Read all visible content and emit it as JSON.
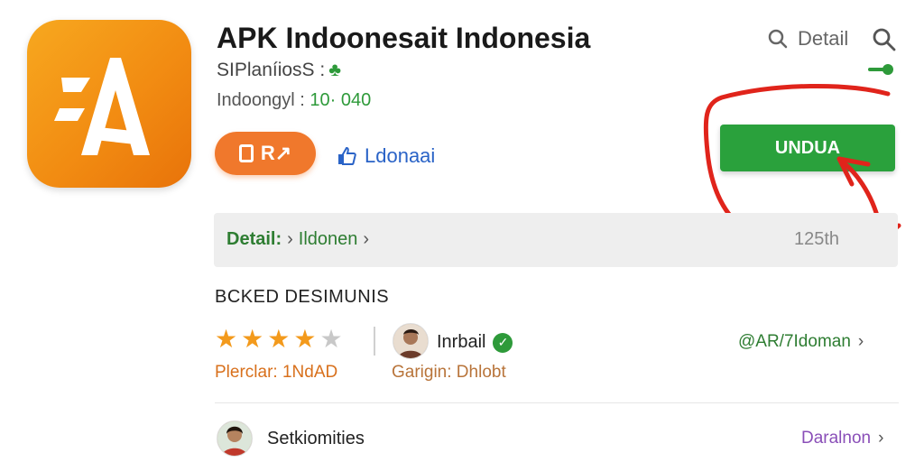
{
  "app": {
    "title": "APK Indoonesait Indonesia",
    "subtitle": "SIPlaníiosS :",
    "meta_prefix": "Indoongyl : ",
    "meta_value": "10· 040"
  },
  "actions": {
    "pill_label": "R↗",
    "link_label": "Ldonaai",
    "download_label": "UNDUA"
  },
  "header": {
    "detail_label": "Detail"
  },
  "detail_bar": {
    "label": "Detail:",
    "crumb": "Ildonen",
    "size": "125th"
  },
  "section": {
    "title": "BCKED DESIMUNIS"
  },
  "rating": {
    "stars": 4,
    "max": 5,
    "caption": "Plerclar: 1NdAD"
  },
  "developer": {
    "name": "Inrbail",
    "caption": "Garigin: Dhlobt",
    "link": "@AR/7Idoman"
  },
  "review": {
    "name": "Setkiomities",
    "link": "Daralnon"
  },
  "colors": {
    "accent_orange": "#f0782c",
    "download_green": "#2aa13c",
    "annotation_red": "#e0241b",
    "link_blue": "#2a63c7"
  }
}
